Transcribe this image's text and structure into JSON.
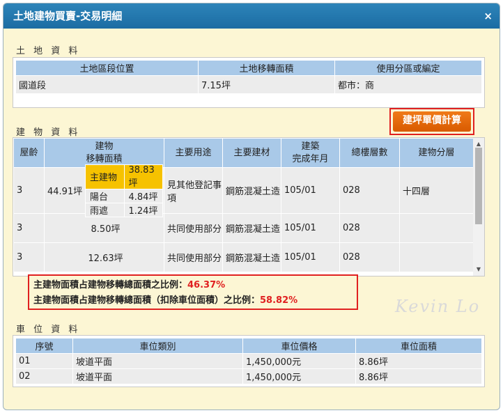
{
  "dialog": {
    "title": "土地建物買賣-交易明細",
    "close_icon": "×"
  },
  "land": {
    "label": "土 地 資 料",
    "headers": [
      "土地區段位置",
      "土地移轉面積",
      "使用分區或編定"
    ],
    "row": [
      "國道段",
      "7.15坪",
      "都市：商"
    ]
  },
  "calc_button": {
    "label": "建坪單價計算"
  },
  "building": {
    "label": "建 物 資 料",
    "headers": [
      "屋齡",
      "建物\n移轉面積",
      "主要用途",
      "主要建材",
      "建築\n完成年月",
      "總樓層數",
      "建物分層"
    ],
    "rows": [
      {
        "age": "3",
        "area": "44.91坪",
        "breakdown": [
          {
            "name": "主建物",
            "value": "38.83坪"
          },
          {
            "name": "陽台",
            "value": "4.84坪"
          },
          {
            "name": "雨遮",
            "value": "1.24坪"
          }
        ],
        "use": "見其他登記事項",
        "material": "鋼筋混凝土造",
        "built": "105/01",
        "floors": "028",
        "level": "十四層"
      },
      {
        "age": "3",
        "area": "8.50坪",
        "use": "共同使用部分",
        "material": "鋼筋混凝土造",
        "built": "105/01",
        "floors": "028",
        "level": ""
      },
      {
        "age": "3",
        "area": "12.63坪",
        "use": "共同使用部分",
        "material": "鋼筋混凝土造",
        "built": "105/01",
        "floors": "028",
        "level": ""
      }
    ]
  },
  "ratios": {
    "line1_label": "主建物面積占建物移轉總面積之比例：",
    "line1_value": "46.37%",
    "line2_label": "主建物面積占建物移轉總面積（扣除車位面積）之比例：",
    "line2_value": "58.82%"
  },
  "watermark": "Kevin Lo",
  "parking": {
    "label": "車 位 資 料",
    "headers": [
      "序號",
      "車位類別",
      "車位價格",
      "車位面積"
    ],
    "rows": [
      [
        "01",
        "坡道平面",
        "1,450,000元",
        "8.86坪"
      ],
      [
        "02",
        "坡道平面",
        "1,450,000元",
        "8.86坪"
      ]
    ]
  },
  "colors": {
    "title_bar": "#1f74ab",
    "header_cell": "#a9c9e8",
    "highlight": "#f6c200",
    "accent_red": "#e02020",
    "button_orange": "#e36a08"
  }
}
